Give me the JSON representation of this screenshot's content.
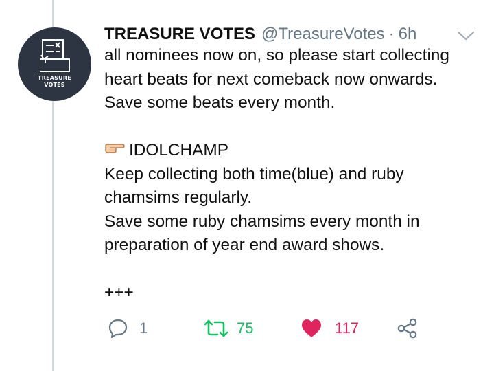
{
  "tweet": {
    "avatar_text": "TREASURE\nVOTES",
    "display_name": "TREASURE VOTES",
    "handle": "@TreasureVotes",
    "separator": "·",
    "time": "6h",
    "lines": [
      "all nominees now on, so please start collecting",
      "heart beats for next comeback now onwards.",
      "Save some beats every month.",
      "",
      "IDOLCHAMP",
      "Keep collecting both time(blue) and ruby",
      "chamsims regularly.",
      "Save some ruby chamsims every month in",
      "preparation of year end award shows.",
      "",
      "+++"
    ]
  },
  "actions": {
    "reply_count": "1",
    "retweet_count": "75",
    "like_count": "117"
  },
  "colors": {
    "text": "#111111",
    "secondary": "#657786",
    "retweet_green": "#17bf63",
    "like_red": "#e0245e",
    "thread_line": "#d3d8dd",
    "avatar_bg": "#2d3442"
  },
  "icons": {
    "caret": "chevron-down-icon",
    "pointing": "pointing-right-emoji",
    "reply": "reply-icon",
    "retweet": "retweet-icon",
    "like": "heart-icon",
    "share": "share-icon"
  }
}
